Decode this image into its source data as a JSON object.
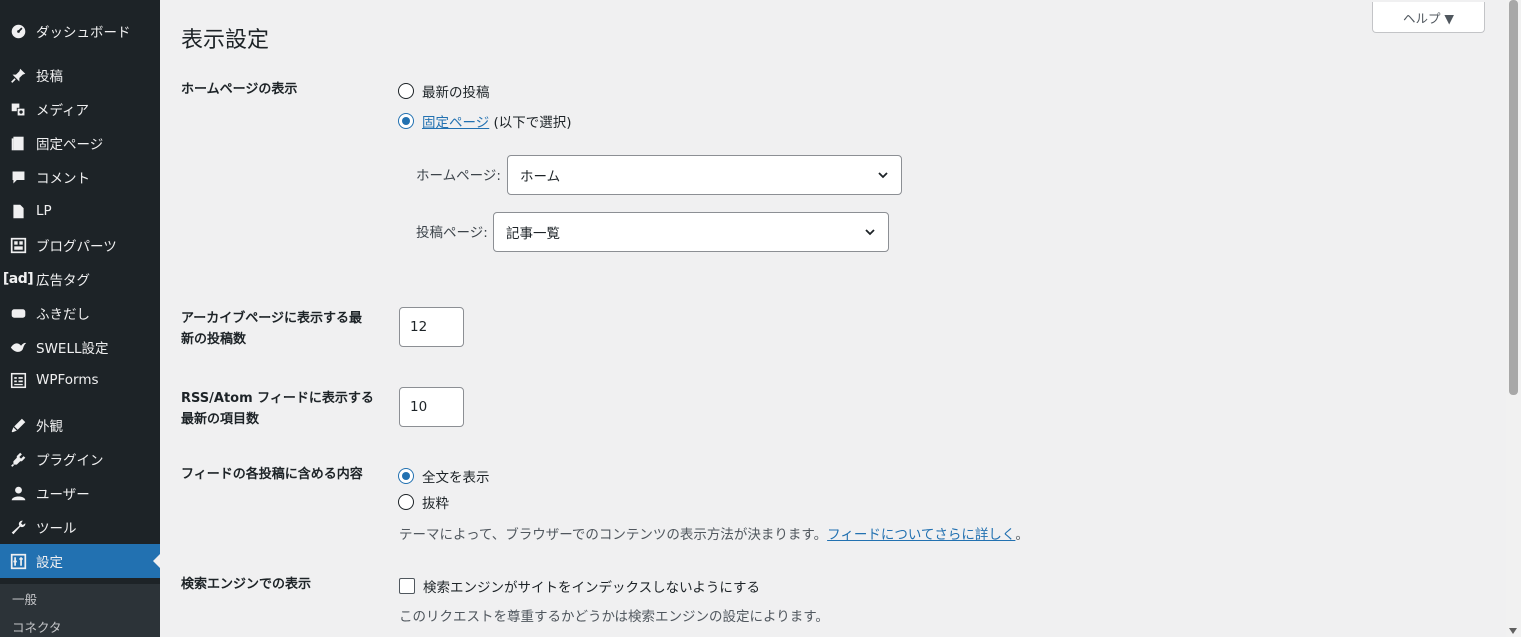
{
  "sidebar": {
    "items": [
      {
        "label": "ダッシュボード",
        "icon": "dashboard-icon"
      },
      {
        "label": "投稿",
        "icon": "pin-icon"
      },
      {
        "label": "メディア",
        "icon": "media-icon"
      },
      {
        "label": "固定ページ",
        "icon": "page-icon"
      },
      {
        "label": "コメント",
        "icon": "comment-icon"
      },
      {
        "label": "LP",
        "icon": "document-icon"
      },
      {
        "label": "ブログパーツ",
        "icon": "blog-parts-icon"
      },
      {
        "label": "広告タグ",
        "icon": "ad-icon",
        "icon_text": "[ad]"
      },
      {
        "label": "ふきだし",
        "icon": "balloon-icon"
      },
      {
        "label": "SWELL設定",
        "icon": "swell-icon"
      },
      {
        "label": "WPForms",
        "icon": "forms-icon"
      },
      {
        "label": "外観",
        "icon": "appearance-icon"
      },
      {
        "label": "プラグイン",
        "icon": "plugin-icon"
      },
      {
        "label": "ユーザー",
        "icon": "user-icon"
      },
      {
        "label": "ツール",
        "icon": "tools-icon"
      },
      {
        "label": "設定",
        "icon": "settings-icon",
        "active": true
      }
    ],
    "submenu": [
      {
        "label": "一般"
      },
      {
        "label": "コネクタ"
      }
    ]
  },
  "header": {
    "title": "表示設定",
    "help_label": "ヘルプ ▼"
  },
  "homepage_display": {
    "label": "ホームページの表示",
    "option_latest": "最新の投稿",
    "option_static_link": "固定ページ",
    "option_static_suffix": " (以下で選択)",
    "selected": "static",
    "homepage_label": "ホームページ:",
    "homepage_value": "ホーム",
    "posts_page_label": "投稿ページ:",
    "posts_page_value": "記事一覧"
  },
  "posts_per_page": {
    "label_line1": "アーカイブページに表示する最",
    "label_line2": "新の投稿数",
    "value": "12"
  },
  "feed_items": {
    "label_line1": "RSS/Atom フィードに表示する",
    "label_line2": "最新の項目数",
    "value": "10"
  },
  "feed_content": {
    "label": "フィードの各投稿に含める内容",
    "option_full": "全文を表示",
    "option_excerpt": "抜粋",
    "selected": "full",
    "description": "テーマによって、ブラウザーでのコンテンツの表示方法が決まります。",
    "description_link": "フィードについてさらに詳しく",
    "description_end": "。"
  },
  "search_visibility": {
    "label": "検索エンジンでの表示",
    "checkbox_label": "検索エンジンがサイトをインデックスしないようにする",
    "checked": false,
    "description": "このリクエストを尊重するかどうかは検索エンジンの設定によります。"
  },
  "colors": {
    "sidebar_bg": "#1d2327",
    "accent": "#2271b1",
    "content_bg": "#f0f0f1"
  }
}
